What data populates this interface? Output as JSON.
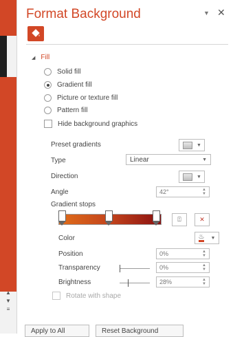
{
  "pane": {
    "title": "Format Background",
    "dropdown_icon": "chevron-down-icon",
    "close_icon": "close-icon",
    "category_icon": "paint-bucket-icon",
    "accent_color": "#d24726"
  },
  "fill": {
    "section_label": "Fill",
    "options": [
      {
        "label": "Solid fill",
        "selected": false
      },
      {
        "label": "Gradient fill",
        "selected": true
      },
      {
        "label": "Picture or texture fill",
        "selected": false
      },
      {
        "label": "Pattern fill",
        "selected": false
      }
    ],
    "hide_bg_label": "Hide background graphics"
  },
  "gradient": {
    "preset_label": "Preset gradients",
    "type_label": "Type",
    "type_value": "Linear",
    "direction_label": "Direction",
    "angle_label": "Angle",
    "angle_value": "42°",
    "stops_label": "Gradient stops",
    "stop_positions_percent": [
      0,
      50,
      100
    ],
    "color_label": "Color",
    "position_label": "Position",
    "position_value": "0%",
    "transparency_label": "Transparency",
    "transparency_value": "0%",
    "transparency_level": 0,
    "brightness_label": "Brightness",
    "brightness_value": "28%",
    "brightness_level": 0.28,
    "rotate_label": "Rotate with shape",
    "rotate_enabled": false
  },
  "footer": {
    "apply_all_label": "Apply to All",
    "reset_label": "Reset Background"
  }
}
